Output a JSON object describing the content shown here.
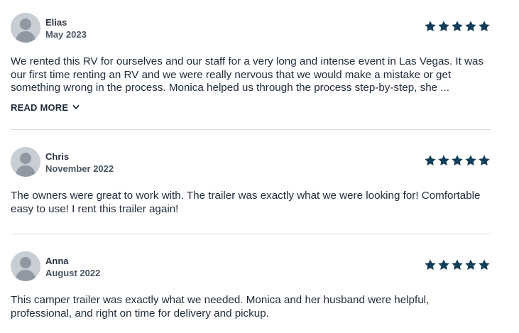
{
  "colors": {
    "star": "#123e5a",
    "avatar_bg": "#c9ced4",
    "divider": "#d8dbdf"
  },
  "reviews": [
    {
      "name": "Elias",
      "date": "May 2023",
      "rating": 5,
      "text": "We rented this RV for ourselves and our staff for a very long and intense event in Las Vegas. It was our first time renting an RV and we were really nervous that we would make a mistake or get something wrong in the process. Monica helped us through the process step-by-step, she ...",
      "read_more_label": "READ MORE"
    },
    {
      "name": "Chris",
      "date": "November 2022",
      "rating": 5,
      "text": "The owners were great to work with. The trailer was exactly what we were looking for! Comfortable easy to use! I rent this trailer again!"
    },
    {
      "name": "Anna",
      "date": "August 2022",
      "rating": 5,
      "text": "This camper trailer was exactly what we needed. Monica and her husband were helpful, professional, and right on time for delivery and pickup."
    }
  ]
}
